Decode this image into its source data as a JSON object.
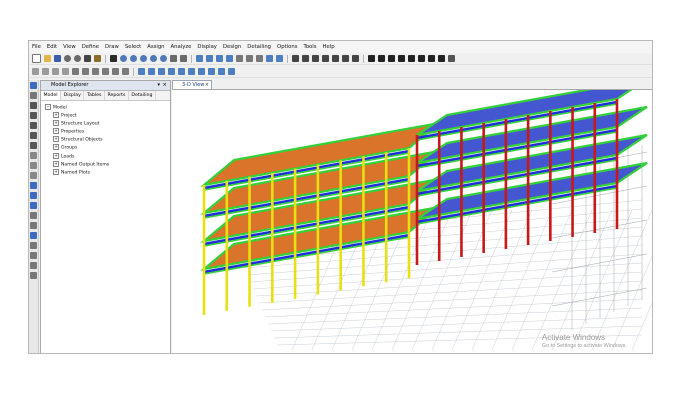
{
  "menu": [
    "File",
    "Edit",
    "View",
    "Define",
    "Draw",
    "Select",
    "Assign",
    "Analyze",
    "Display",
    "Design",
    "Detailing",
    "Options",
    "Tools",
    "Help"
  ],
  "explorer": {
    "title": "Model Explorer",
    "close_icon": "×",
    "tabs": [
      "Model",
      "Display",
      "Tables",
      "Reports",
      "Detailing"
    ],
    "root": "Model",
    "children": [
      "Project",
      "Structure Layout",
      "Properties",
      "Structural Objects",
      "Groups",
      "Loads",
      "Named Output Items",
      "Named Plots"
    ]
  },
  "view": {
    "tab_label": "3-D View",
    "close_icon": "×"
  },
  "watermark": {
    "title": "Activate Windows",
    "subtitle": "Go to Settings to activate Windows."
  },
  "colors": {
    "slab": "#d9742a",
    "beam_green": "#35d13a",
    "beam_blue": "#1f2fd8",
    "column_red": "#c81818",
    "column_yellow": "#e8e010",
    "grid": "#bcc3ca"
  }
}
